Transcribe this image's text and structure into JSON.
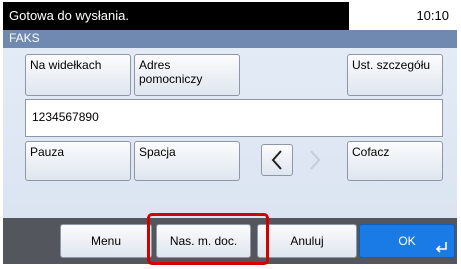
{
  "status": {
    "message": "Gotowa do wysłania.",
    "time": "10:10"
  },
  "title": "FAKS",
  "buttons": {
    "hook": "Na widełkach",
    "address_line1": "Adres",
    "address_line2": "pomocniczy",
    "detail": "Ust. szczegółu",
    "pause": "Pauza",
    "space": "Spacja",
    "backspace": "Cofacz"
  },
  "fax_number": "1234567890",
  "bottom": {
    "menu": "Menu",
    "send_doc": "Nas. m. doc.",
    "cancel": "Anuluj",
    "ok": "OK"
  },
  "colors": {
    "ok_button": "#1a7ae6",
    "highlight": "#d40000",
    "titlebar": "#6f89b1"
  },
  "icons": [
    "cursor-left-icon",
    "cursor-right-icon",
    "enter-icon"
  ]
}
